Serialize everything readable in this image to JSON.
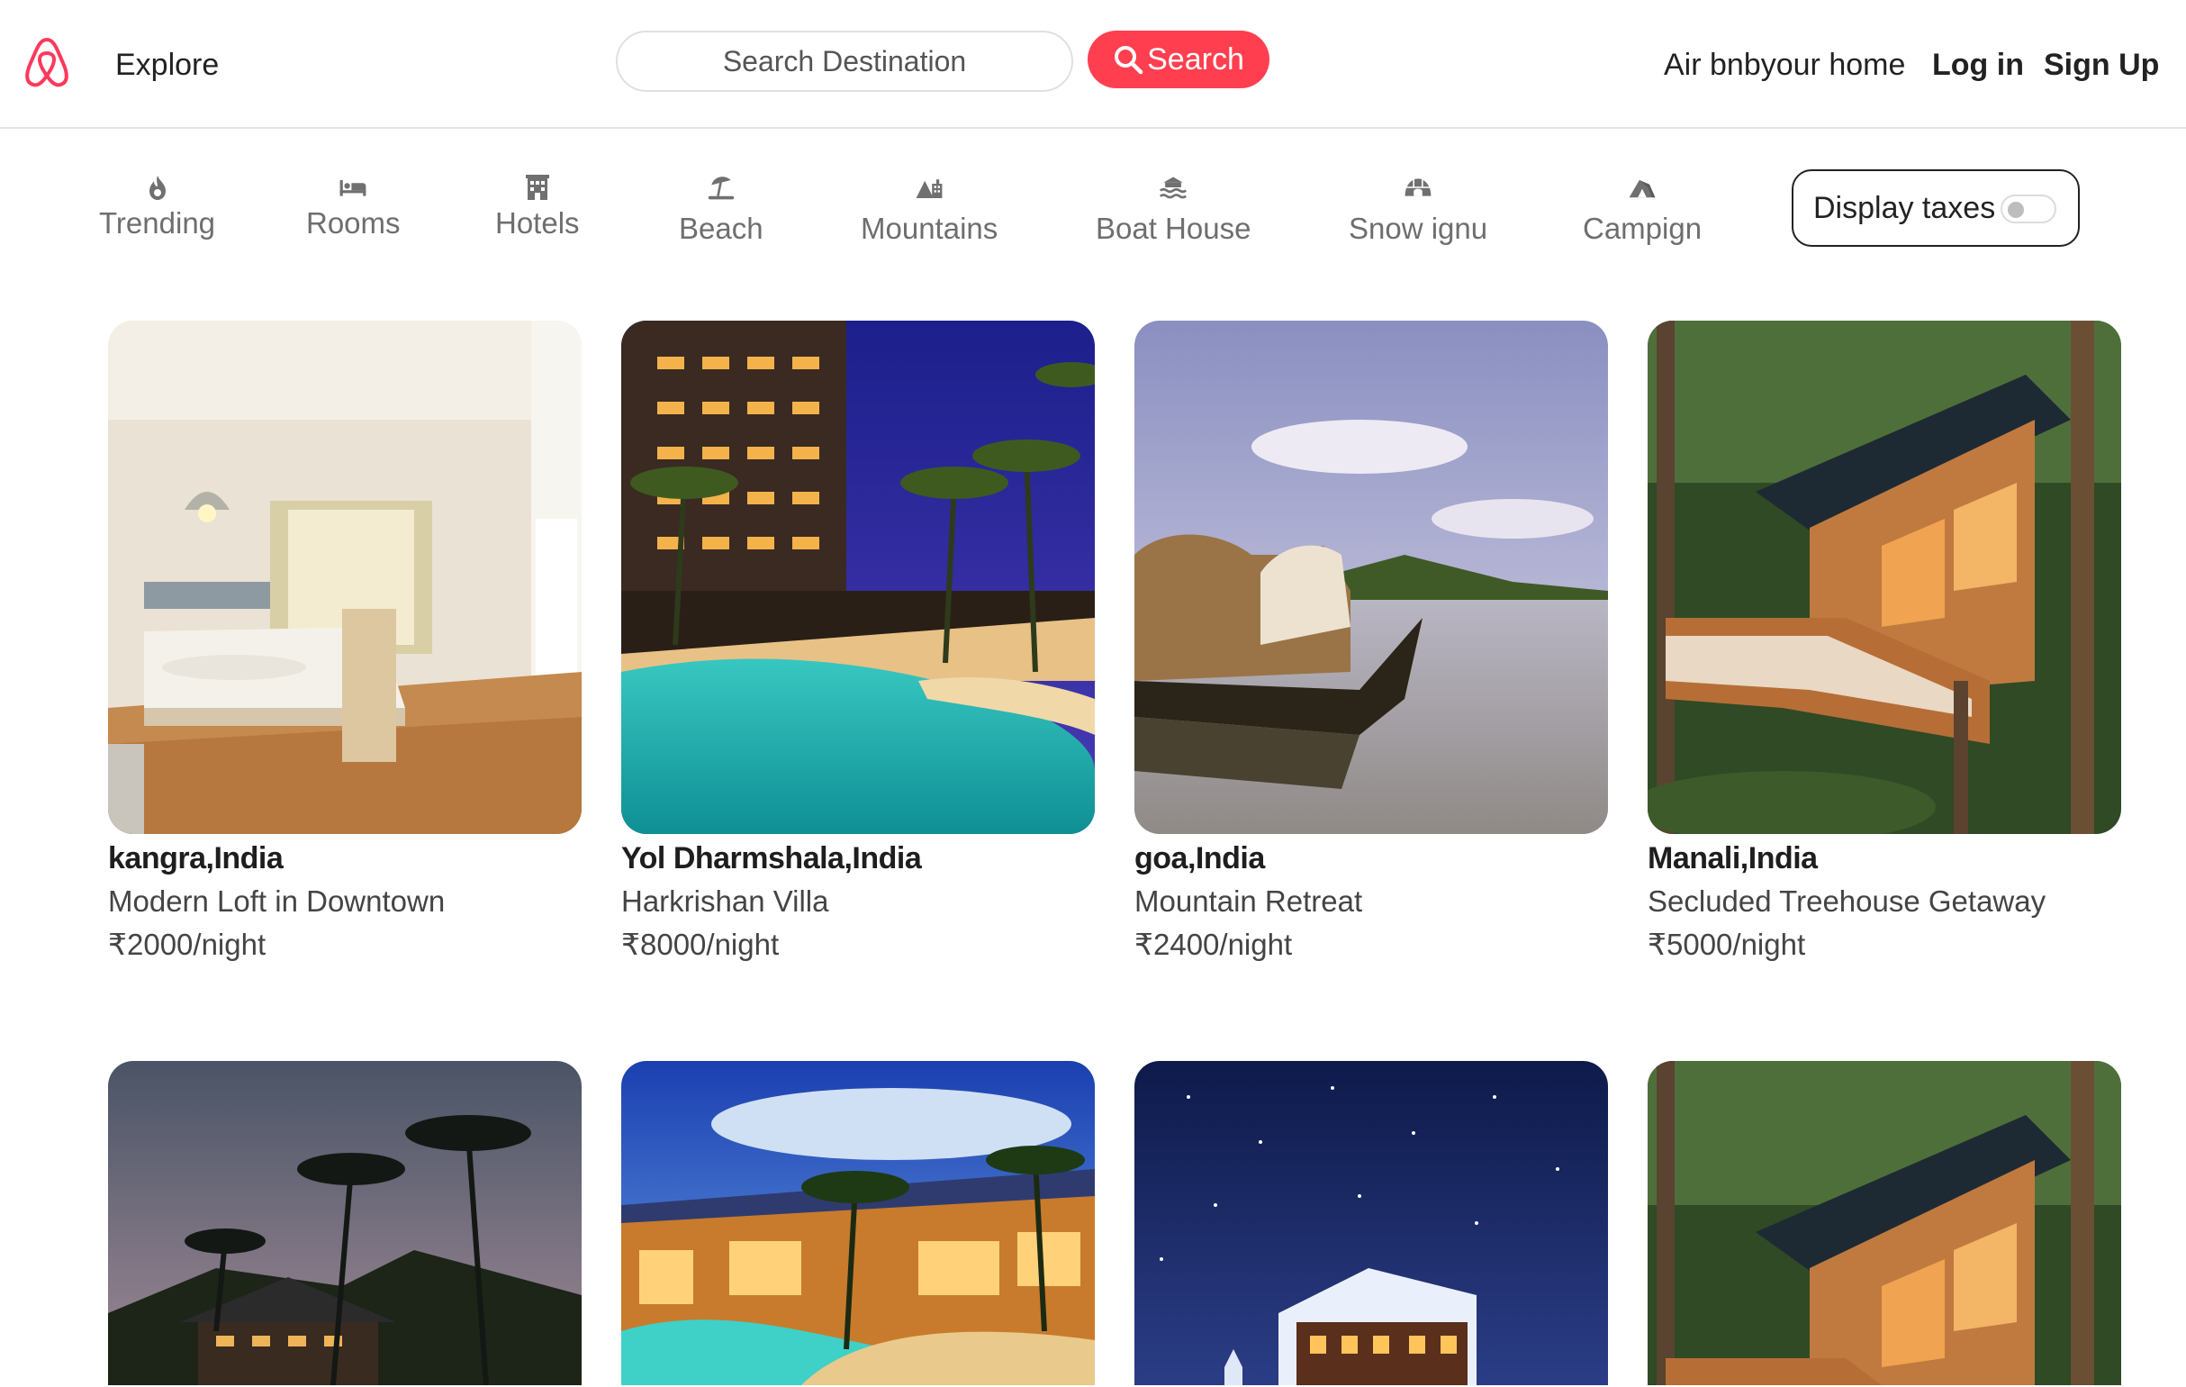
{
  "header": {
    "explore": "Explore",
    "search_placeholder": "Search Destination",
    "search_button": "Search",
    "host_link": "Air bnbyour home",
    "login": "Log in",
    "signup": "Sign Up"
  },
  "filters": [
    {
      "label": "Trending",
      "icon": "fire-icon"
    },
    {
      "label": "Rooms",
      "icon": "bed-icon"
    },
    {
      "label": "Hotels",
      "icon": "hotel-icon"
    },
    {
      "label": "Beach",
      "icon": "umbrella-beach-icon"
    },
    {
      "label": "Mountains",
      "icon": "mountain-city-icon"
    },
    {
      "label": "Boat House",
      "icon": "water-icon"
    },
    {
      "label": "Snow ignu",
      "icon": "igloo-icon"
    },
    {
      "label": "Campign",
      "icon": "campground-icon"
    }
  ],
  "taxes": {
    "label": "Display taxes",
    "enabled": false
  },
  "listings": [
    {
      "location": "kangra,India",
      "title": "Modern Loft in Downtown",
      "price": "₹2000/night",
      "photo": "hotel-room-photo"
    },
    {
      "location": "Yol Dharmshala,India",
      "title": "Harkrishan Villa",
      "price": "₹8000/night",
      "photo": "resort-pool-photo"
    },
    {
      "location": "goa,India",
      "title": "Mountain Retreat",
      "price": "₹2400/night",
      "photo": "houseboat-photo"
    },
    {
      "location": "Manali,India",
      "title": "Secluded Treehouse Getaway",
      "price": "₹5000/night",
      "photo": "treehouse-photo"
    },
    {
      "photo": "palm-resort-photo"
    },
    {
      "photo": "luxury-villa-photo"
    },
    {
      "photo": "snow-cabin-photo"
    },
    {
      "photo": "treehouse-photo"
    }
  ],
  "colors": {
    "brand": "#ff385c",
    "search_button": "#ff3f4f"
  }
}
